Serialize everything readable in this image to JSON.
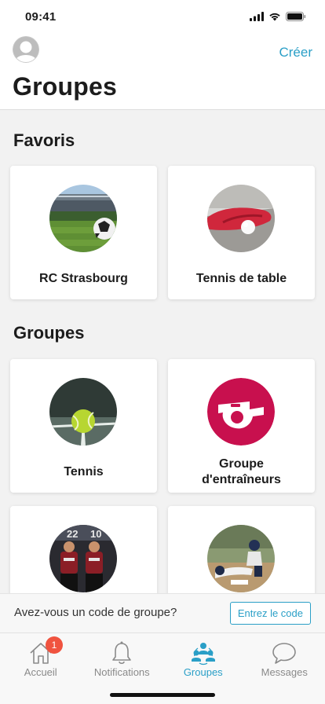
{
  "status_bar": {
    "time": "09:41"
  },
  "header": {
    "create_label": "Créer",
    "title": "Groupes"
  },
  "favorites": {
    "title": "Favoris",
    "items": [
      {
        "label": "RC Strasbourg",
        "icon": "stadium-photo"
      },
      {
        "label": "Tennis de table",
        "icon": "ping-pong-photo"
      }
    ]
  },
  "groups": {
    "title": "Groupes",
    "items": [
      {
        "label": "Tennis",
        "icon": "tennis-ball-photo"
      },
      {
        "label": "Groupe",
        "label2": "d'entraîneurs",
        "icon": "whistle-icon",
        "color": "#c8104e"
      },
      {
        "label": "",
        "icon": "hockey-players-photo"
      },
      {
        "label": "",
        "icon": "baseball-slide-photo"
      }
    ]
  },
  "code_bar": {
    "prompt": "Avez-vous un code de groupe?",
    "button": "Entrez le code"
  },
  "tabbar": {
    "items": [
      {
        "label": "Accueil",
        "icon": "home-icon",
        "badge": "1"
      },
      {
        "label": "Notifications",
        "icon": "bell-icon"
      },
      {
        "label": "Groupes",
        "icon": "groups-icon",
        "active": true
      },
      {
        "label": "Messages",
        "icon": "chat-bubble-icon"
      }
    ]
  },
  "colors": {
    "accent": "#2a9fc7",
    "badge": "#f0533f",
    "whistle_bg": "#c8104e"
  }
}
